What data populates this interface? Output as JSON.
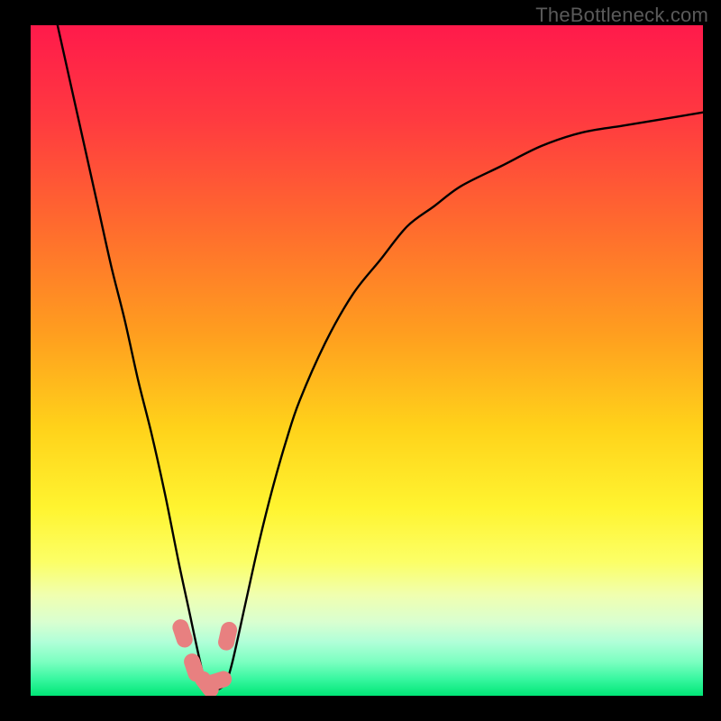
{
  "watermark": "TheBottleneck.com",
  "chart_data": {
    "type": "line",
    "title": "",
    "xlabel": "",
    "ylabel": "",
    "xlim": [
      0,
      100
    ],
    "ylim": [
      0,
      100
    ],
    "grid": false,
    "legend": false,
    "annotations": [],
    "series": [
      {
        "name": "curve",
        "x": [
          4,
          6,
          8,
          10,
          12,
          14,
          16,
          18,
          20,
          22,
          23.5,
          25,
          26,
          27,
          28,
          29,
          30,
          32,
          34,
          36,
          38,
          40,
          44,
          48,
          52,
          56,
          60,
          64,
          70,
          76,
          82,
          88,
          94,
          100
        ],
        "y": [
          100,
          91,
          82,
          73,
          64,
          56,
          47,
          39,
          30,
          20,
          13,
          6,
          2,
          1,
          1,
          2,
          5,
          14,
          23,
          31,
          38,
          44,
          53,
          60,
          65,
          70,
          73,
          76,
          79,
          82,
          84,
          85,
          86,
          87
        ]
      }
    ],
    "markers": {
      "name": "highlight",
      "x": [
        22.6,
        24.3,
        26.2,
        27.8,
        29.3
      ],
      "y": [
        9.3,
        4.2,
        1.7,
        2.2,
        8.9
      ]
    },
    "gradient_stops": [
      {
        "offset": 0.0,
        "color": "#ff1a4b"
      },
      {
        "offset": 0.14,
        "color": "#ff3a40"
      },
      {
        "offset": 0.3,
        "color": "#ff6b2e"
      },
      {
        "offset": 0.46,
        "color": "#ff9e1f"
      },
      {
        "offset": 0.6,
        "color": "#ffd21a"
      },
      {
        "offset": 0.72,
        "color": "#fff430"
      },
      {
        "offset": 0.8,
        "color": "#fcff66"
      },
      {
        "offset": 0.85,
        "color": "#f0ffb0"
      },
      {
        "offset": 0.89,
        "color": "#d9ffd0"
      },
      {
        "offset": 0.92,
        "color": "#b0ffd8"
      },
      {
        "offset": 0.95,
        "color": "#7affc0"
      },
      {
        "offset": 0.975,
        "color": "#38f7a0"
      },
      {
        "offset": 1.0,
        "color": "#00e676"
      }
    ],
    "marker_color": "#e88080"
  }
}
